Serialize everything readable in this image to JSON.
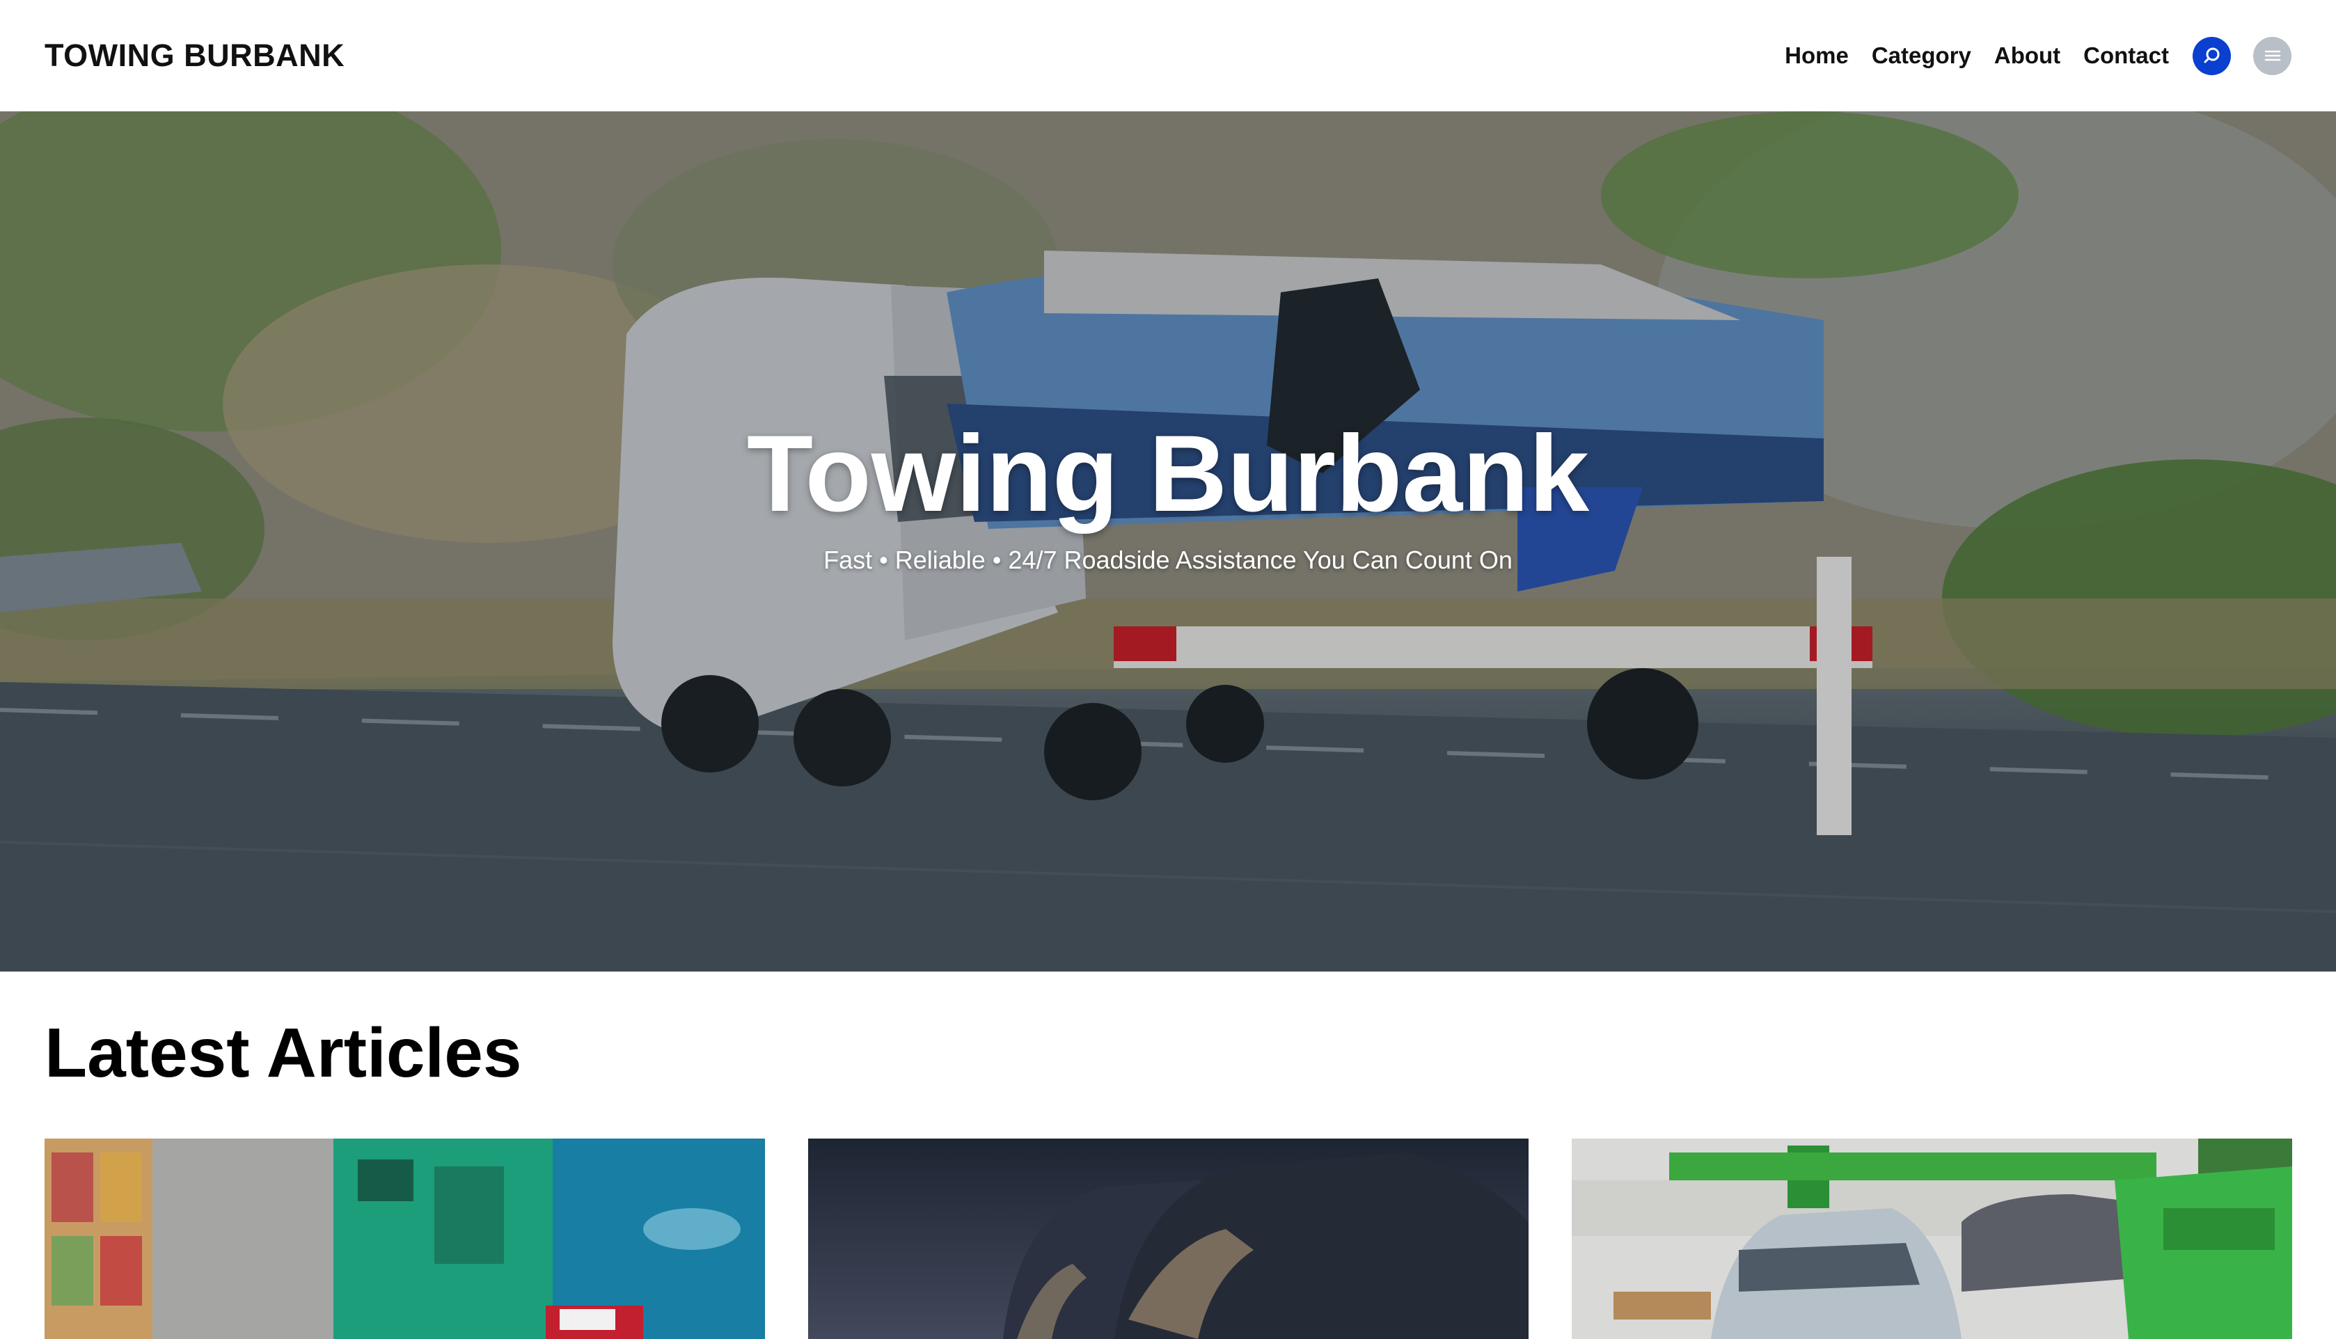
{
  "header": {
    "brand": "TOWING BURBANK",
    "nav": [
      "Home",
      "Category",
      "About",
      "Contact"
    ],
    "icons": {
      "search": "search-icon",
      "menu": "menu-icon"
    },
    "colors": {
      "search_button": "#0a3fd0",
      "menu_button": "#b9bfc6"
    }
  },
  "hero": {
    "title": "Towing Burbank",
    "subtitle": "Fast • Reliable • 24/7 Roadside Assistance You Can Count On",
    "image": "van-towing-boat-trailer-photo"
  },
  "latest": {
    "heading": "Latest Articles",
    "cards": [
      {
        "image": "cargo-ship-aerial-photo"
      },
      {
        "image": "covered-cars-photo"
      },
      {
        "image": "green-tow-truck-photo"
      }
    ]
  }
}
